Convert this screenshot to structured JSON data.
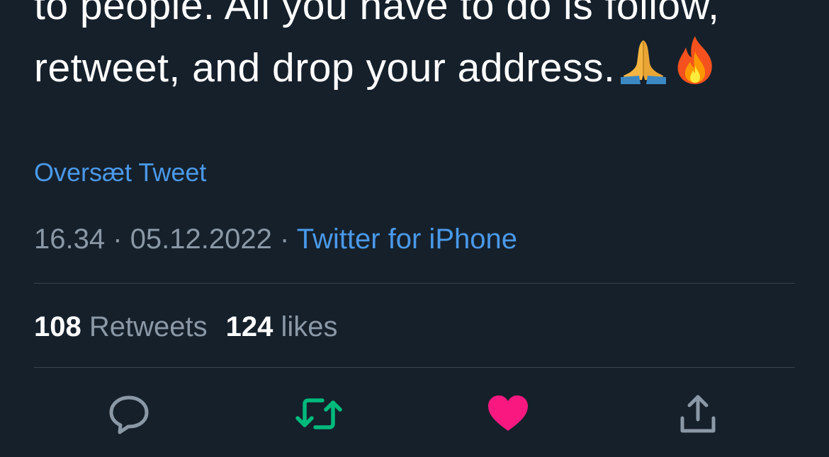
{
  "tweet": {
    "text_line1": "to people. All you have to do is follow,",
    "text_line2": "retweet, and drop your address.",
    "emojis": [
      "folded-hands",
      "fire"
    ]
  },
  "translate_label": "Oversæt Tweet",
  "meta": {
    "time": "16.34",
    "separator": "·",
    "date": "05.12.2022",
    "source": "Twitter for iPhone"
  },
  "stats": {
    "retweets_count": "108",
    "retweets_label": "Retweets",
    "likes_count": "124",
    "likes_label": "likes"
  },
  "actions": {
    "reply_icon": "reply-icon",
    "retweet_icon": "retweet-icon",
    "like_icon": "heart-icon",
    "share_icon": "share-icon"
  },
  "colors": {
    "background": "#15202b",
    "text": "#ffffff",
    "secondary": "#8b98a5",
    "link": "#4a99e9",
    "retweet_active": "#00ba7c",
    "like_active": "#f91880",
    "divider": "#38444d"
  }
}
